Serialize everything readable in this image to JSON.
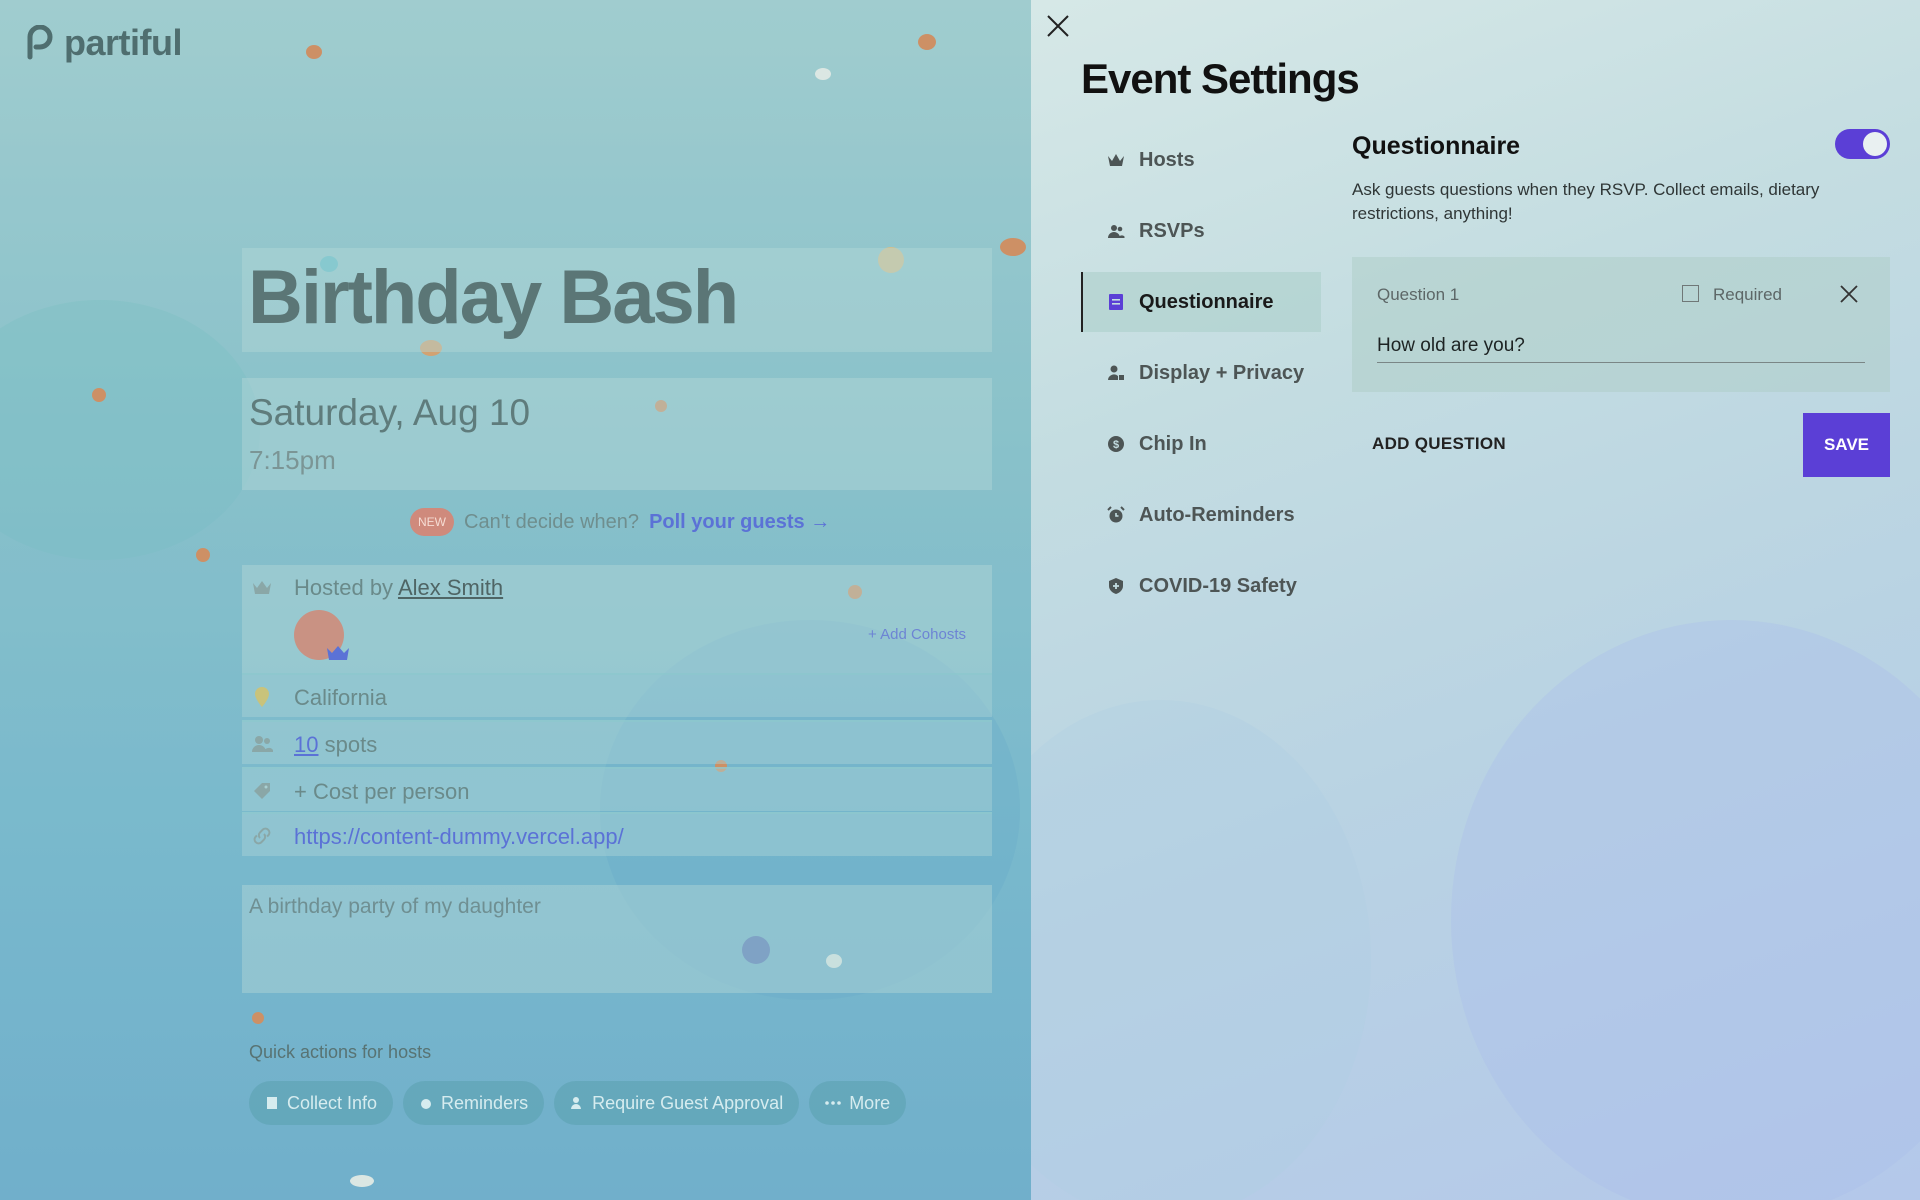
{
  "brand": {
    "logo_text": "partiful"
  },
  "event": {
    "title": "Birthday Bash",
    "date": "Saturday, Aug 10",
    "time": "7:15pm",
    "poll": {
      "badge": "NEW",
      "question": "Can't decide when?",
      "link": "Poll your guests →"
    },
    "host": {
      "prefix": "Hosted by",
      "name": "Alex Smith",
      "add_cohosts": "+ Add Cohosts"
    },
    "location": "California",
    "spots": {
      "count": "10",
      "suffix": "spots"
    },
    "cost": "+ Cost per person",
    "url": "https://content-dummy.vercel.app/",
    "description": "A birthday party of my daughter",
    "quick_actions": {
      "label": "Quick actions for hosts",
      "buttons": [
        "Collect Info",
        "Reminders",
        "Require Guest Approval",
        "More"
      ]
    }
  },
  "settings": {
    "title": "Event Settings",
    "nav": [
      {
        "label": "Hosts",
        "icon": "crown-icon"
      },
      {
        "label": "RSVPs",
        "icon": "people-icon"
      },
      {
        "label": "Questionnaire",
        "icon": "form-icon",
        "active": true
      },
      {
        "label": "Display + Privacy",
        "icon": "person-lock-icon"
      },
      {
        "label": "Chip In",
        "icon": "dollar-icon"
      },
      {
        "label": "Auto-Reminders",
        "icon": "alarm-icon"
      },
      {
        "label": "COVID-19 Safety",
        "icon": "shield-icon"
      }
    ],
    "questionnaire": {
      "header": "Questionnaire",
      "enabled": true,
      "description": "Ask guests questions when they RSVP. Collect emails, dietary restrictions, anything!",
      "questions": [
        {
          "label": "Question 1",
          "required_label": "Required",
          "required": false,
          "value": "How old are you?"
        }
      ],
      "add_label": "ADD QUESTION",
      "save_label": "SAVE"
    },
    "colors": {
      "accent": "#5b3fd6"
    }
  }
}
